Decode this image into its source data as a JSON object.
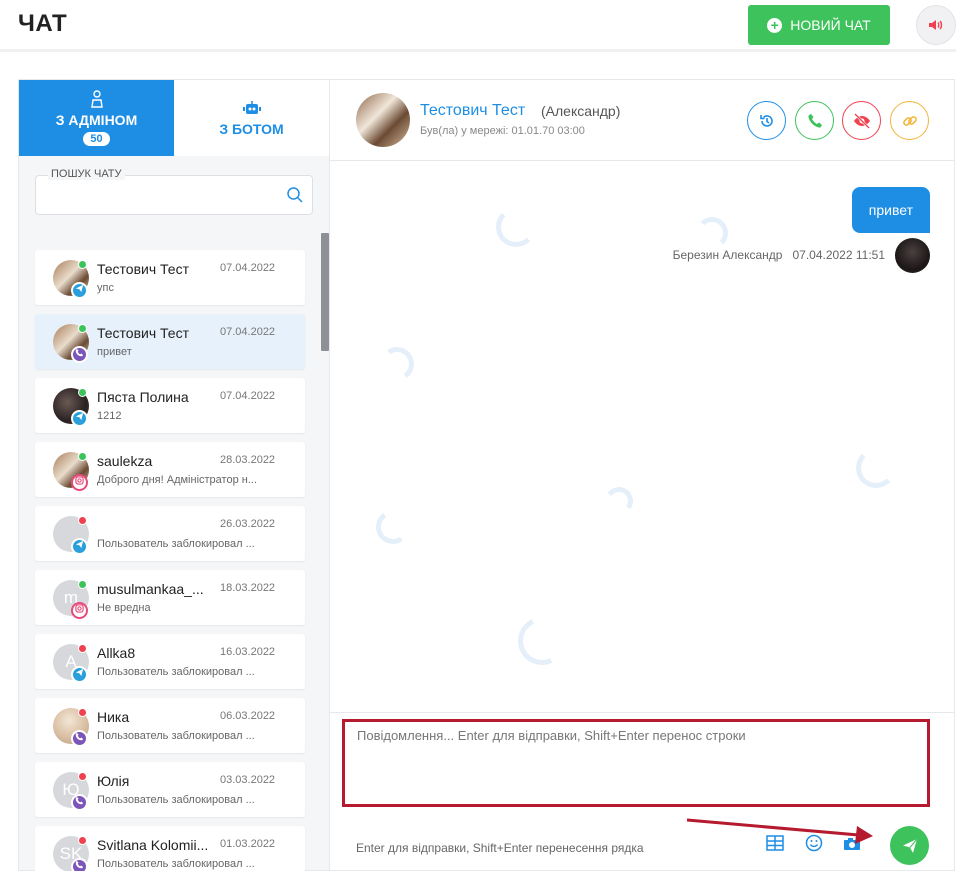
{
  "header": {
    "title": "ЧАТ",
    "new_chat_label": "НОВИЙ ЧАТ",
    "accent": "#3ec25c"
  },
  "tabs": {
    "admin_label": "З АДМІНОМ",
    "admin_badge": "50",
    "bot_label": "З БОТОМ",
    "active_color": "#1e8ee5"
  },
  "search": {
    "label": "ПОШУК ЧАТУ",
    "value": ""
  },
  "chats": [
    {
      "name": "Тестович Тест",
      "date": "07.04.2022",
      "preview": "упс",
      "avatar_letter": "",
      "avatar": "dog-photo",
      "status": "online",
      "source": "telegram"
    },
    {
      "name": "Тестович Тест",
      "date": "07.04.2022",
      "preview": "привет",
      "avatar_letter": "",
      "avatar": "dog-photo",
      "status": "online",
      "source": "viber"
    },
    {
      "name": "Пяста Полина",
      "date": "07.04.2022",
      "preview": "1212",
      "avatar_letter": "",
      "avatar": "dark-photo",
      "status": "online",
      "source": "telegram"
    },
    {
      "name": "saulekza",
      "date": "28.03.2022",
      "preview": "Доброго дня! Адміністратор н...",
      "avatar_letter": "",
      "avatar": "dog-photo",
      "status": "online",
      "source": "instagram"
    },
    {
      "name": "",
      "date": "26.03.2022",
      "preview": "Пользователь заблокировал ...",
      "avatar_letter": "",
      "avatar": "blank",
      "status": "offline",
      "source": "telegram"
    },
    {
      "name": "musulmankaa_...",
      "date": "18.03.2022",
      "preview": "Не вредна",
      "avatar_letter": "m",
      "avatar": "letter",
      "status": "online",
      "source": "instagram"
    },
    {
      "name": "Allka8",
      "date": "16.03.2022",
      "preview": "Пользователь заблокировал ...",
      "avatar_letter": "A",
      "avatar": "letter",
      "status": "offline",
      "source": "telegram"
    },
    {
      "name": "Ника",
      "date": "06.03.2022",
      "preview": "Пользователь заблокировал ...",
      "avatar_letter": "",
      "avatar": "light-photo",
      "status": "offline",
      "source": "viber"
    },
    {
      "name": "Юлія",
      "date": "03.03.2022",
      "preview": "Пользователь заблокировал ...",
      "avatar_letter": "Ю",
      "avatar": "letter",
      "status": "offline",
      "source": "viber"
    },
    {
      "name": "Svitlana Kolomii...",
      "date": "01.03.2022",
      "preview": "Пользователь заблокировал ...",
      "avatar_letter": "SK",
      "avatar": "letter",
      "status": "offline",
      "source": "viber"
    }
  ],
  "contact": {
    "name": "Тестович Тест",
    "real_name": "(Александр)",
    "status": "Був(ла) у мережі: 01.01.70 03:00"
  },
  "messages": [
    {
      "text": "привет",
      "author": "Березин Александр",
      "time": "07.04.2022 11:51",
      "direction": "outgoing"
    }
  ],
  "composer": {
    "placeholder": "Повідомлення... Enter для відправки, Shift+Enter перенос строки",
    "value": "",
    "hint": "Enter для відправки, Shift+Enter перенесення рядка",
    "highlight_color": "#b51a2e"
  },
  "icons": {
    "new_chat": "plus-circle-icon",
    "sound": "speaker-icon",
    "history": "history-icon",
    "call": "phone-icon",
    "block": "block-icon",
    "link": "link-icon",
    "templates": "table-icon",
    "emoji": "smile-icon",
    "photo": "camera-icon",
    "send": "paper-plane-icon"
  }
}
